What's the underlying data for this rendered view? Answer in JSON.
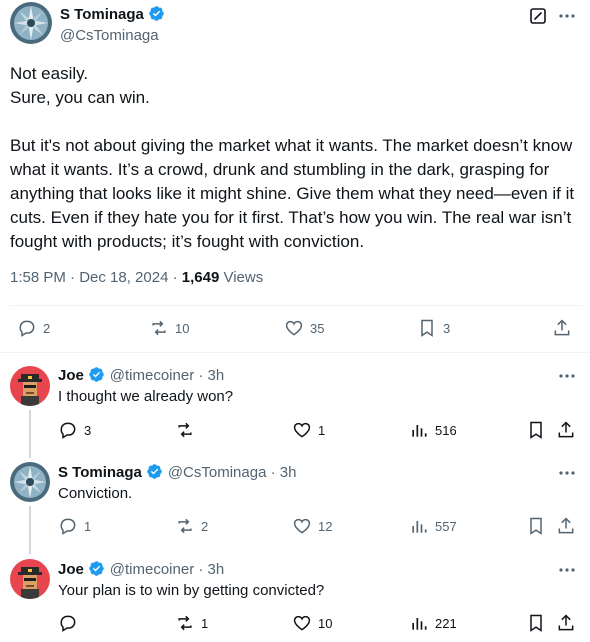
{
  "main_tweet": {
    "author_name": "S Tominaga",
    "author_handle": "@CsTominaga",
    "text": "Not easily.\nSure, you can win.\n\nBut it's not about giving the market what it wants. The market doesn’t know what it wants. It’s a crowd, drunk and stumbling in the dark, grasping for anything that looks like it might shine. Give them what they need—even if it cuts. Even if they hate you for it first. That’s how you win. The real war isn’t fought with products; it’s fought with conviction.",
    "time": "1:58 PM · Dec 18, 2024 · ",
    "views_count": "1,649",
    "views_label": " Views",
    "replies": "2",
    "reposts": "10",
    "likes": "35",
    "bookmarks": "3"
  },
  "replies": [
    {
      "author_name": "Joe",
      "author_handle": "@timecoiner · 3h",
      "text": "I thought we already won?",
      "replies": "3",
      "reposts": "",
      "likes": "1",
      "views": "516"
    },
    {
      "author_name": "S Tominaga",
      "author_handle": "@CsTominaga · 3h",
      "text": "Conviction.",
      "replies": "1",
      "reposts": "2",
      "likes": "12",
      "views": "557"
    },
    {
      "author_name": "Joe",
      "author_handle": "@timecoiner · 3h",
      "text": "Your plan is to win by getting convicted?",
      "replies": "",
      "reposts": "1",
      "likes": "10",
      "views": "221"
    }
  ],
  "colors": {
    "text": "#0f1419",
    "secondary": "#536471",
    "verified": "#1d9bf0",
    "divider": "#eff3f4"
  }
}
